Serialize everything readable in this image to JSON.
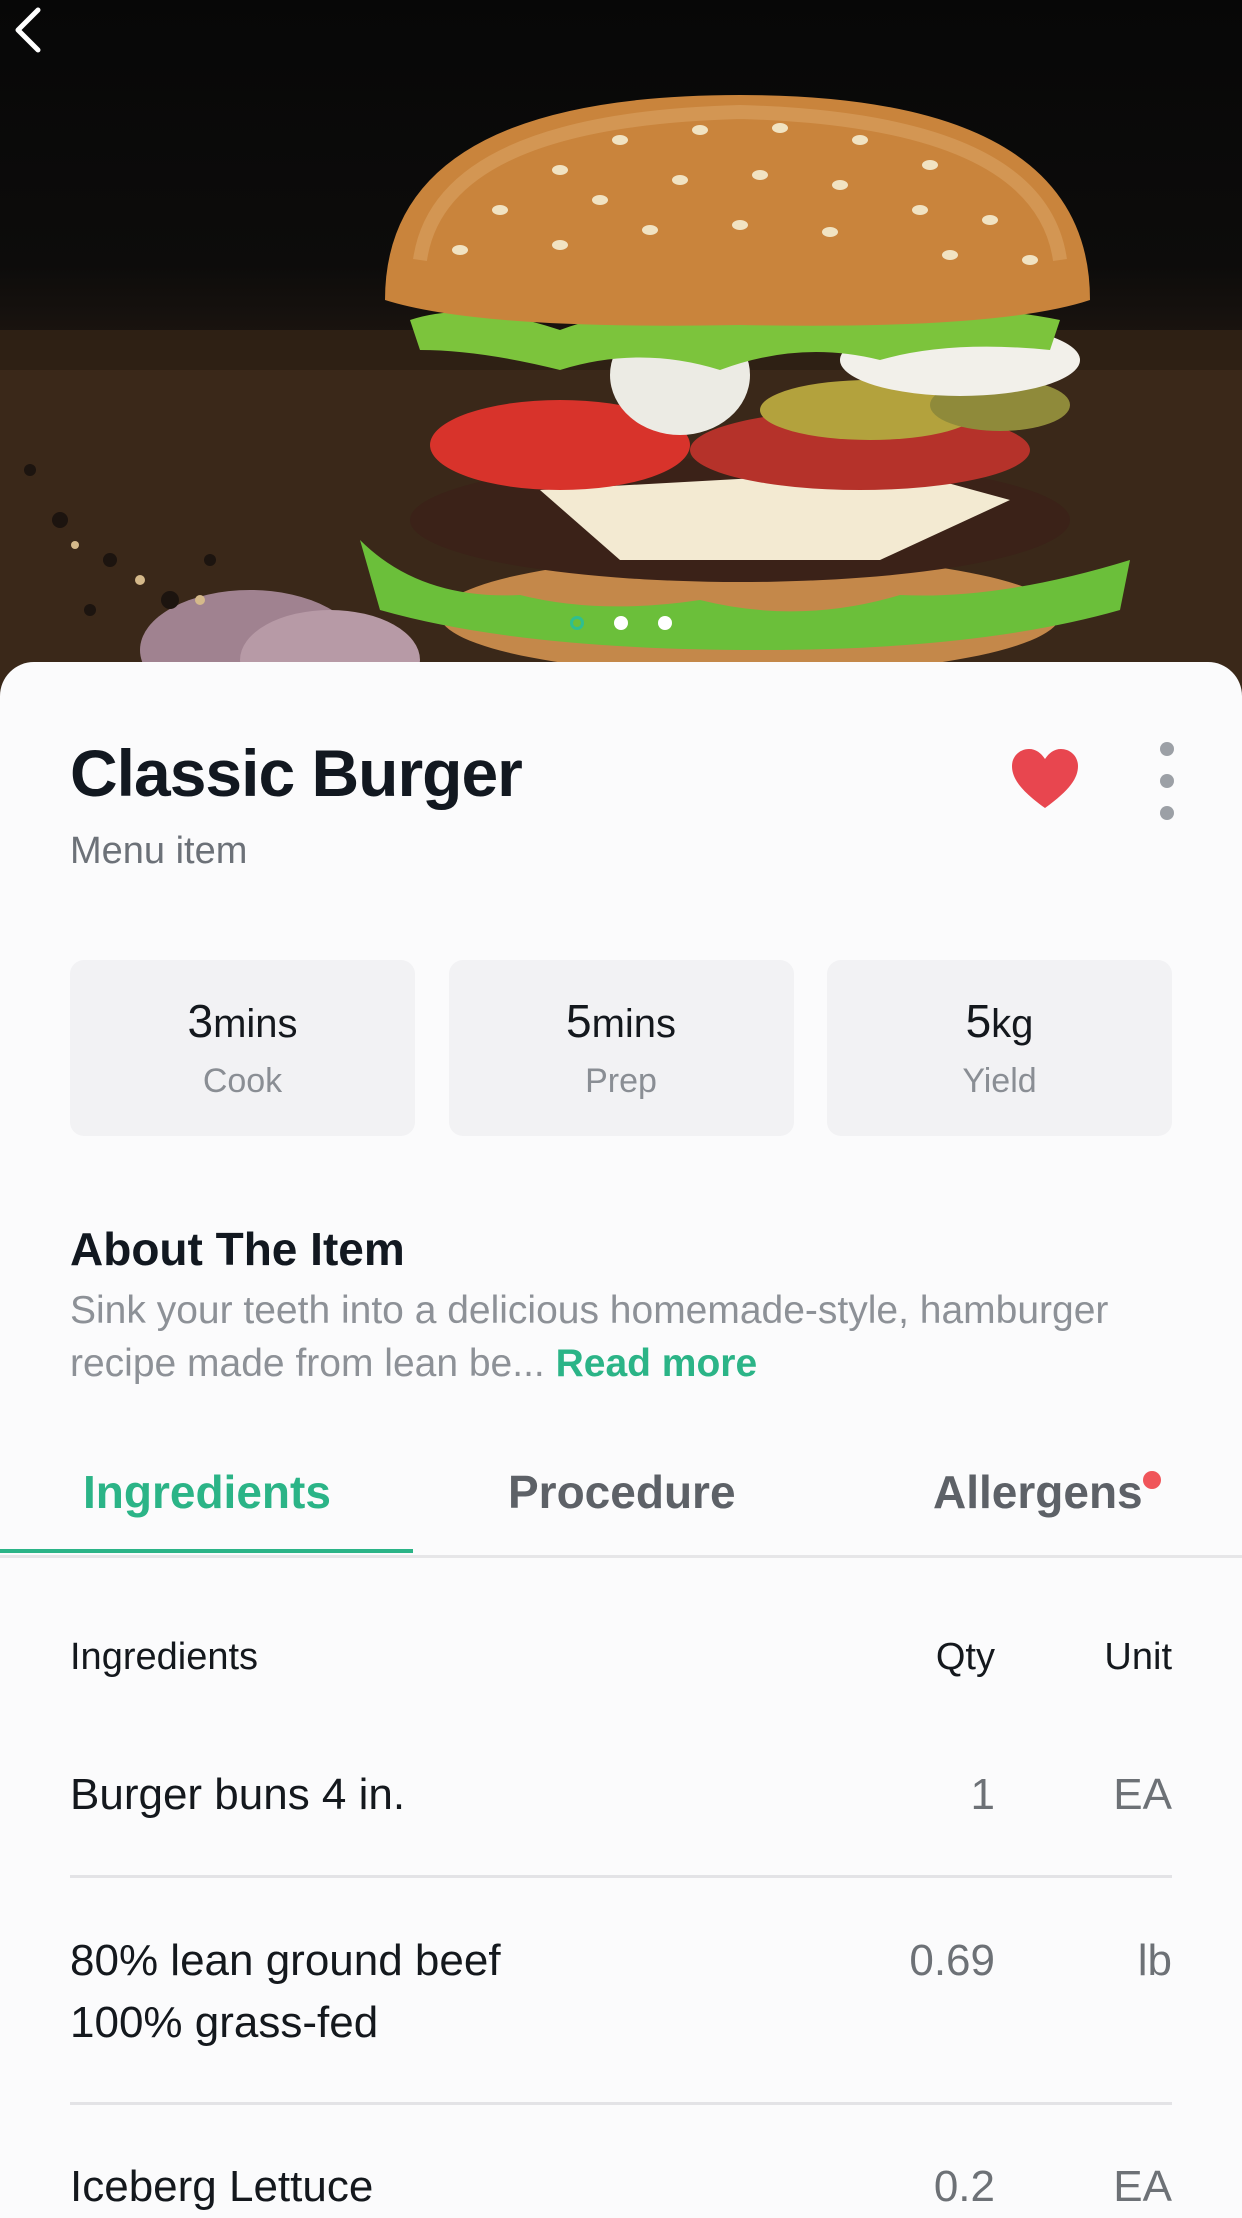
{
  "hero": {
    "image_alt": "Classic Burger photo",
    "carousel_dots": 3,
    "active_dot": 0
  },
  "item": {
    "title": "Classic Burger",
    "subtitle": "Menu item",
    "favorite": true
  },
  "stats": [
    {
      "value": "3",
      "unit": "mins",
      "label": "Cook"
    },
    {
      "value": "5",
      "unit": "mins",
      "label": "Prep"
    },
    {
      "value": "5",
      "unit": "kg",
      "label": "Yield"
    }
  ],
  "about": {
    "heading": "About The Item",
    "text": "Sink your teeth into a delicious homemade-style, hamburger recipe made from lean be...",
    "read_more": "Read more"
  },
  "tabs": [
    {
      "label": "Ingredients",
      "active": true,
      "alert": false
    },
    {
      "label": "Procedure",
      "active": false,
      "alert": false
    },
    {
      "label": "Allergens",
      "active": false,
      "alert": true
    }
  ],
  "table": {
    "headers": {
      "name": "Ingredients",
      "qty": "Qty",
      "unit": "Unit"
    },
    "rows": [
      {
        "name": "Burger buns 4 in.",
        "qty": "1",
        "unit": "EA"
      },
      {
        "name_line1": "80% lean ground beef",
        "name_line2": "100% grass-fed",
        "qty": "0.69",
        "unit": "lb"
      },
      {
        "name": "Iceberg Lettuce",
        "qty": "0.2",
        "unit": "EA"
      }
    ]
  },
  "colors": {
    "accent": "#2bb487",
    "heart": "#e8464f",
    "alert": "#f0555a"
  }
}
